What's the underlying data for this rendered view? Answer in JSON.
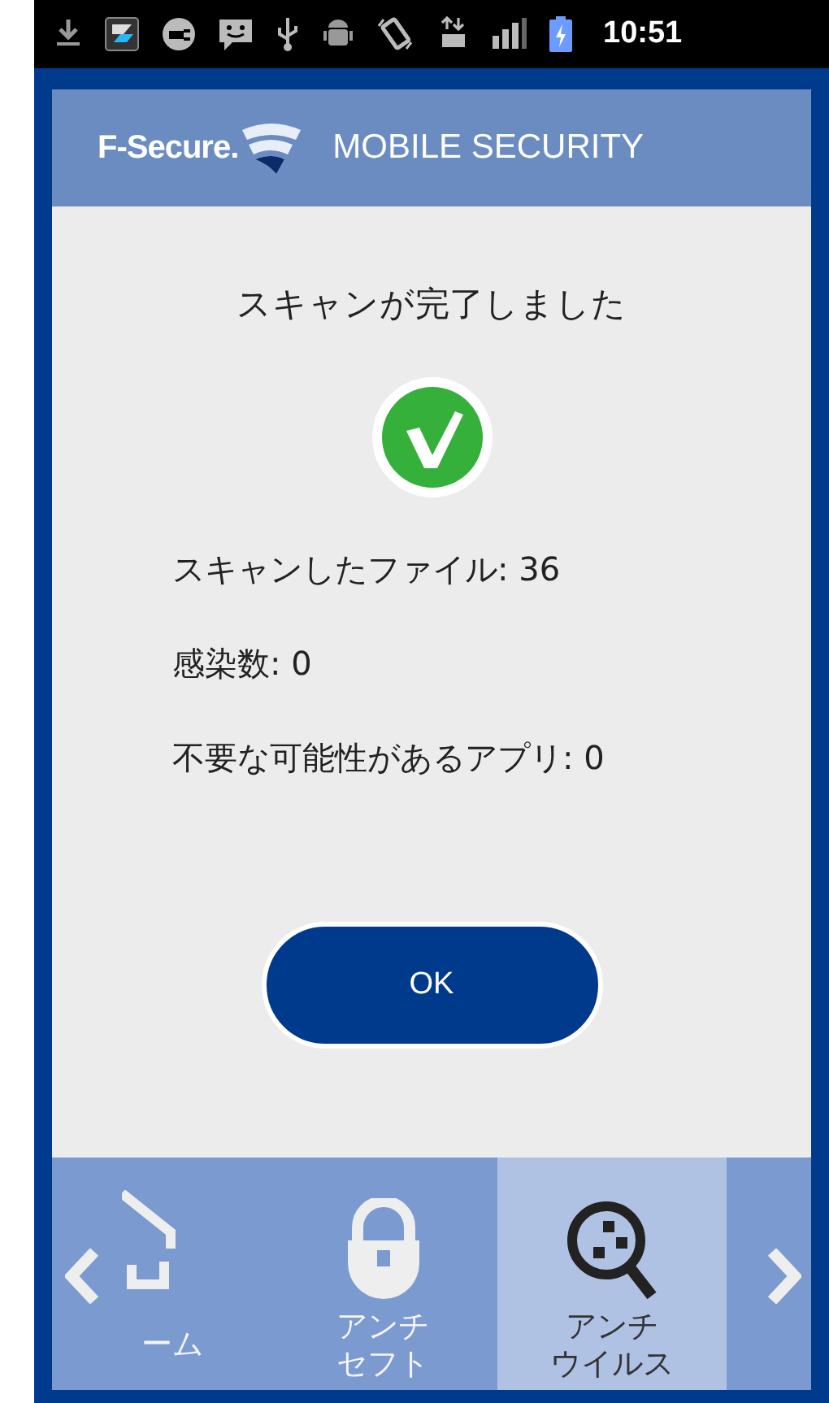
{
  "status_bar": {
    "time": "10:51"
  },
  "header": {
    "brand": "F-Secure.",
    "product": "MOBILE SECURITY"
  },
  "result": {
    "title": "スキャンが完了しました",
    "stats": [
      "スキャンしたファイル: 36",
      "感染数: 0",
      "不要な可能性があるアプリ: 0"
    ],
    "ok_button": "OK"
  },
  "nav": {
    "tabs": [
      {
        "kind": "home",
        "label_lines": [
          "ーム"
        ],
        "selected": false
      },
      {
        "kind": "lock",
        "label_lines": [
          "アンチ",
          "セフト"
        ],
        "selected": false
      },
      {
        "kind": "virus",
        "label_lines": [
          "アンチ",
          "ウイルス"
        ],
        "selected": true
      }
    ]
  }
}
